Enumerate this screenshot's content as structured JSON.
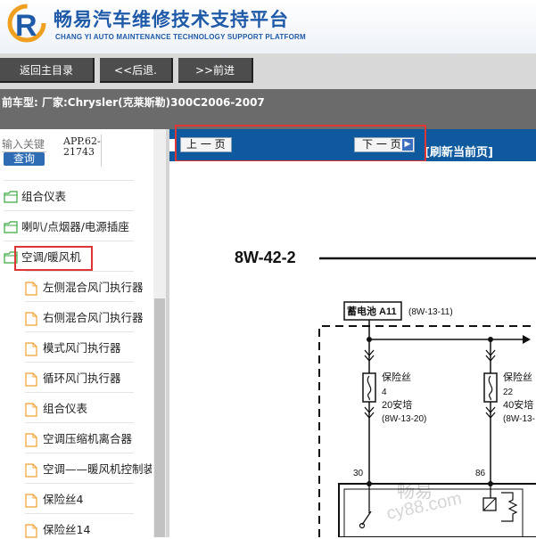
{
  "header": {
    "brand_cn": "畅易汽车维修技术支持平台",
    "brand_en": "CHANG YI AUTO MAINTENANCE TECHNOLOGY SUPPORT PLATFORM"
  },
  "toolbar": {
    "home_label": "返回主目录",
    "back_label": "<<后退.",
    "forward_label": ">>前进"
  },
  "vehicle_info": "前车型:  厂家:Chrysler(克莱斯勒)300C2006-2007",
  "search": {
    "placeholder": "输入关键",
    "button_label": "查询",
    "code": "APP.62-21743"
  },
  "tree": [
    {
      "label": "组合仪表",
      "type": "folder"
    },
    {
      "label": "喇叭/点烟器/电源插座",
      "type": "folder"
    },
    {
      "label": "空调/暖风机",
      "type": "folder",
      "selected": true
    },
    {
      "label": "左侧混合风门执行器",
      "type": "doc"
    },
    {
      "label": "右侧混合风门执行器",
      "type": "doc"
    },
    {
      "label": "模式风门执行器",
      "type": "doc"
    },
    {
      "label": "循环风门执行器",
      "type": "doc"
    },
    {
      "label": "组合仪表",
      "type": "doc"
    },
    {
      "label": "空调压缩机离合器",
      "type": "doc"
    },
    {
      "label": "空调——暖风机控制装",
      "type": "doc"
    },
    {
      "label": "保险丝4",
      "type": "doc"
    },
    {
      "label": "保险丝14",
      "type": "doc"
    }
  ],
  "diagram_nav": {
    "prev_label": "上 一 页",
    "next_label": "下 一 页",
    "refresh_label": "[刷新当前页]"
  },
  "diagram": {
    "page_code": "8W-42-2",
    "battery_label": "蓄电池 A11",
    "battery_ref": "(8W-13-11)",
    "fuse1_title": "保险丝",
    "fuse1_number": "4",
    "fuse1_rating": "20安培",
    "fuse1_ref": "(8W-13-20)",
    "fuse2_title": "保险丝",
    "fuse2_number": "22",
    "fuse2_rating": "40安培",
    "fuse2_ref": "(8W-13-",
    "pin1": "30",
    "pin2": "86",
    "watermark1": "畅易",
    "watermark2": "cy88.com"
  },
  "colors": {
    "brand_blue": "#1f5aa8",
    "toolbar_button": "#4d4d4d",
    "info_bar": "#6b6b6b",
    "diagram_bar": "#0f5a9e",
    "highlight": "#e03535"
  }
}
